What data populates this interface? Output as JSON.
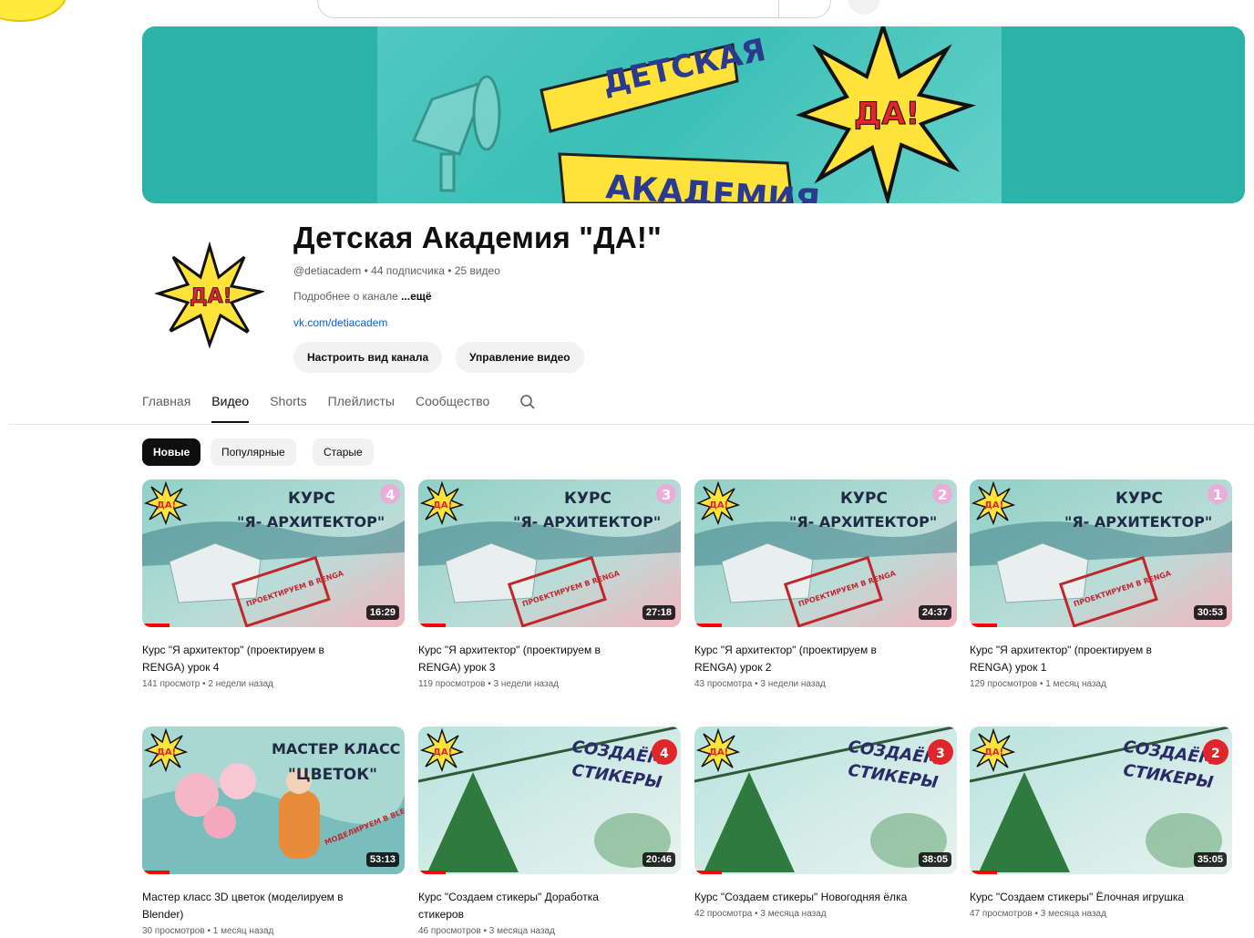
{
  "channel": {
    "title": "Детская Академия \"ДА!\"",
    "handle": "@detiacadem",
    "subscribers": "44 подписчика",
    "video_count": "25 видео",
    "meta_sep": " • ",
    "about": "Подробнее о канале",
    "more": "...ещё",
    "link": "vk.com/detiacadem",
    "banner_line1": "ДЕТСКАЯ",
    "banner_line2": "АКАДЕМИЯ",
    "logo": "ДА!"
  },
  "actions": {
    "customize": "Настроить вид канала",
    "manage": "Управление видео"
  },
  "tabs": [
    "Главная",
    "Видео",
    "Shorts",
    "Плейлисты",
    "Сообщество"
  ],
  "active_tab": "Видео",
  "chips": [
    "Новые",
    "Популярные",
    "Старые"
  ],
  "active_chip": "Новые",
  "videos": [
    {
      "title": "Курс \"Я архитектор\" (проектируем в RENGA) урок 4",
      "views": "141 просмотр",
      "age": "2 недели назад",
      "duration": "16:29",
      "thumb_title": "КУРС",
      "thumb_subtitle": "\"Я- АРХИТЕКТОР\"",
      "badge": "4",
      "stamp": "ПРОЕКТИРУЕМ В RENGA"
    },
    {
      "title": "Курс \"Я архитектор\" (проектируем в RENGA) урок 3",
      "views": "119 просмотров",
      "age": "3 недели назад",
      "duration": "27:18",
      "thumb_title": "КУРС",
      "thumb_subtitle": "\"Я- АРХИТЕКТОР\"",
      "badge": "3",
      "stamp": "ПРОЕКТИРУЕМ В RENGA"
    },
    {
      "title": "Курс \"Я архитектор\" (проектируем в RENGA) урок 2",
      "views": "43 просмотра",
      "age": "3 недели назад",
      "duration": "24:37",
      "thumb_title": "КУРС",
      "thumb_subtitle": "\"Я- АРХИТЕКТОР\"",
      "badge": "2",
      "stamp": "ПРОЕКТИРУЕМ В RENGA"
    },
    {
      "title": "Курс \"Я архитектор\" (проектируем в RENGA) урок 1",
      "views": "129 просмотров",
      "age": "1 месяц назад",
      "duration": "30:53",
      "thumb_title": "КУРС",
      "thumb_subtitle": "\"Я- АРХИТЕКТОР\"",
      "badge": "1",
      "stamp": "ПРОЕКТИРУЕМ В RENGA"
    },
    {
      "title": "Мастер класс 3D цветок (моделируем в Blender)",
      "views": "30 просмотров",
      "age": "1 месяц назад",
      "duration": "53:13",
      "thumb_title": "МАСТЕР КЛАСС",
      "thumb_subtitle": "\"ЦВЕТОК\"",
      "badge": "",
      "stamp": "МОДЕЛИРУЕМ В BLENDER"
    },
    {
      "title": "Курс \"Создаем стикеры\" Доработка стикеров",
      "views": "46 просмотров",
      "age": "3 месяца назад",
      "duration": "20:46",
      "thumb_title": "СОЗДАЁМ",
      "thumb_subtitle": "СТИКЕРЫ",
      "badge": "4",
      "stamp": ""
    },
    {
      "title": "Курс \"Создаем стикеры\" Новогодняя ёлка",
      "views": "42 просмотра",
      "age": "3 месяца назад",
      "duration": "38:05",
      "thumb_title": "СОЗДАЁМ",
      "thumb_subtitle": "СТИКЕРЫ",
      "badge": "3",
      "stamp": ""
    },
    {
      "title": "Курс \"Создаем стикеры\" Ёлочная игрушка",
      "views": "47 просмотров",
      "age": "3 месяца назад",
      "duration": "35:05",
      "thumb_title": "СОЗДАЁМ",
      "thumb_subtitle": "СТИКЕРЫ",
      "badge": "2",
      "stamp": ""
    }
  ],
  "colors": {
    "banner_bg": "#2bb3a7",
    "thumb_teal": "#7fc4bd",
    "thumb_pink": "#f2a7b4",
    "star_yellow": "#ffe23a",
    "red_badge": "#e0262b",
    "progress_red": "#ff0000",
    "link_blue": "#065fd4"
  },
  "icons": {
    "search_tab": "search-icon",
    "banner_megaphone": "megaphone-icon"
  }
}
